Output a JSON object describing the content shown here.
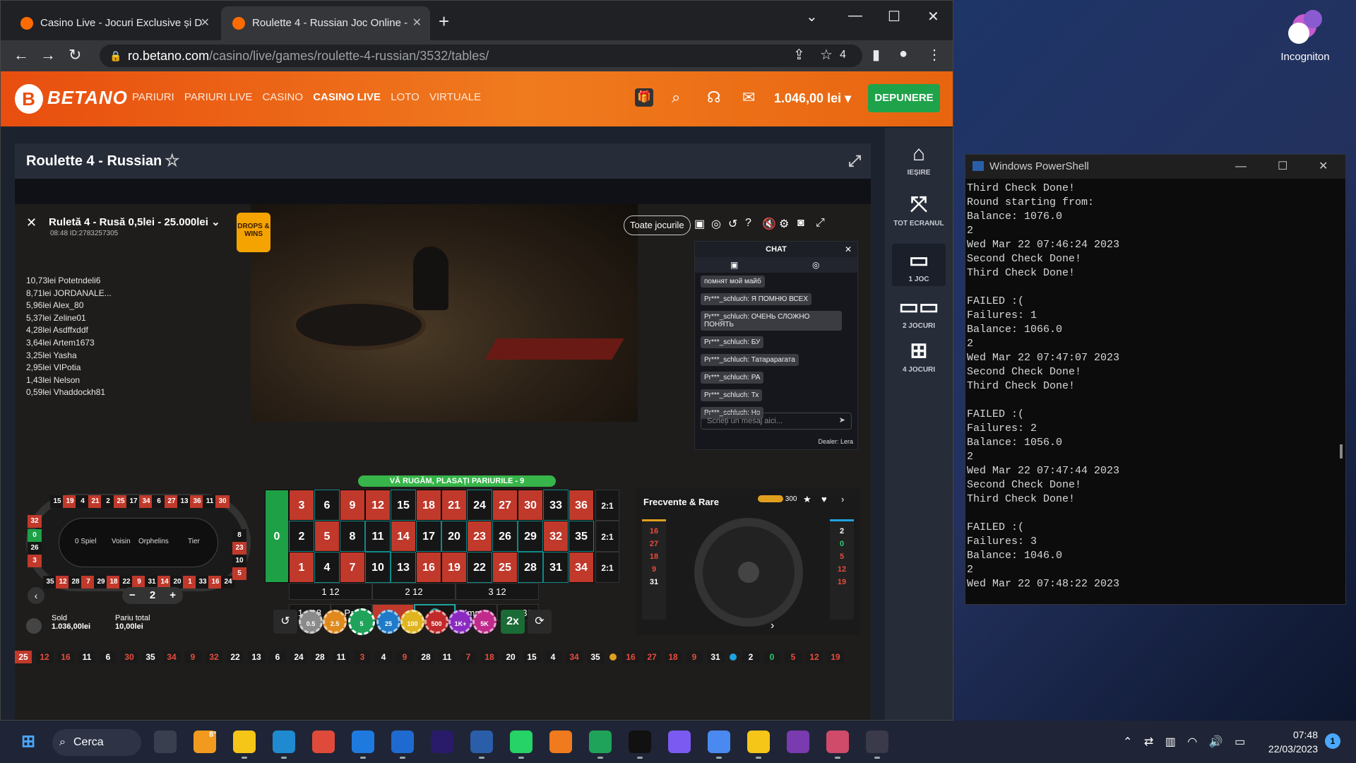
{
  "desktop": {
    "incognito_label": "Incogniton"
  },
  "browser": {
    "tabs": [
      {
        "title": "Casino Live - Jocuri Exclusive și D"
      },
      {
        "title": "Roulette 4 - Russian Joc Online -"
      }
    ],
    "url_host": "ro.betano.com",
    "url_path": "/casino/live/games/roulette-4-russian/3532/tables/",
    "extension_count": "4"
  },
  "betano": {
    "logo": "BETANO",
    "nav": [
      "PARIURI",
      "PARIURI LIVE",
      "CASINO",
      "CASINO LIVE",
      "LOTO",
      "VIRTUALE"
    ],
    "balance": "1.046,00 lei",
    "deposit": "DEPUNERE",
    "game_title": "Roulette 4 - Russian",
    "sidebar": [
      {
        "label": "IEȘIRE",
        "icon": "home-icon"
      },
      {
        "label": "TOT ECRANUL",
        "icon": "fullscreen-icon"
      },
      {
        "label": "1 JOC",
        "icon": "single-screen-icon"
      },
      {
        "label": "2 JOCURI",
        "icon": "two-screens-icon"
      },
      {
        "label": "4 JOCURI",
        "icon": "four-screens-icon"
      }
    ]
  },
  "game": {
    "name": "Ruletă 4 - Rusă 0,5lei - 25.000lei",
    "sub": "08:48 ID:2783257305",
    "drops": "DROPS & WINS",
    "all_games": "Toate jocurile",
    "winners": [
      "10,73lei Potetndeli6",
      "8,71lei JORDANALE...",
      "5,96lei Alex_80",
      "5,37lei Zeline01",
      "4,28lei Asdffxddf",
      "3,64lei Artem1673",
      "3,25lei Yasha",
      "2,95lei VIPotia",
      "1,43lei Nelson",
      "0,59lei Vhaddockh81"
    ],
    "chat": {
      "title": "CHAT",
      "messages": [
        "помнят мой майб",
        "Pr***_schluch: Я ПОМНЮ ВСЕХ",
        "Pr***_schluch: ОЧЕНЬ СЛОЖНО ПОНЯТЬ",
        "Pr***_schluch: БУ",
        "Pr***_schluch: Татарарагата",
        "Pr***_schluch: РА",
        "Pr***_schluch: Тх",
        "Pr***_schluch: Но"
      ],
      "placeholder": "Scrieți un mesaj aici...",
      "dealer": "Dealer: Lera"
    },
    "status": "VĂ RUGĂM, PLASAȚI PARIURILE - 9",
    "race_labels": [
      "0 Spiel",
      "Voisin",
      "Orphelins",
      "Tier"
    ],
    "table_rows": [
      [
        "3",
        "6",
        "9",
        "12",
        "15",
        "18",
        "21",
        "24",
        "27",
        "30",
        "33",
        "36"
      ],
      [
        "2",
        "5",
        "8",
        "11",
        "14",
        "17",
        "20",
        "23",
        "26",
        "29",
        "32",
        "35"
      ],
      [
        "1",
        "4",
        "7",
        "10",
        "13",
        "16",
        "19",
        "22",
        "25",
        "28",
        "31",
        "34"
      ]
    ],
    "red_numbers": [
      "1",
      "3",
      "5",
      "7",
      "9",
      "12",
      "14",
      "16",
      "18",
      "19",
      "21",
      "23",
      "25",
      "27",
      "30",
      "32",
      "34",
      "36"
    ],
    "zero": "0",
    "column_bets": [
      "2:1",
      "2:1",
      "2:1"
    ],
    "dozens": [
      "1 12",
      "2 12",
      "3 12"
    ],
    "outside": [
      "1 - 18",
      "Par",
      "",
      "",
      "Impar",
      "19 - 36"
    ],
    "chips": [
      "0.5",
      "2.5",
      "5",
      "25",
      "100",
      "500",
      "1K+",
      "5K"
    ],
    "double": "2x",
    "bet_multiplier": "2",
    "sold_label": "Sold",
    "sold_value": "1.036,00lei",
    "total_label": "Pariu total",
    "total_value": "10,00lei",
    "freq_title": "Frecvente & Rare",
    "freq_count": "300",
    "cold": [
      "16",
      "27",
      "18",
      "9",
      "31"
    ],
    "hot": [
      "2",
      "0",
      "5",
      "12",
      "19"
    ],
    "history": [
      "25",
      "12",
      "16",
      "11",
      "6",
      "30",
      "35",
      "34",
      "9",
      "32",
      "22",
      "13",
      "6",
      "24",
      "28",
      "11",
      "3",
      "4",
      "9",
      "28",
      "11",
      "7",
      "18",
      "20",
      "15",
      "4",
      "34",
      "35"
    ],
    "history_cold": [
      "16",
      "27",
      "18",
      "9",
      "31"
    ],
    "history_hot": [
      "2",
      "0",
      "5",
      "12",
      "19"
    ]
  },
  "powershell": {
    "title": "Windows PowerShell",
    "lines": "Third Check Done!\nRound starting from:\nBalance: 1076.0\n2\nWed Mar 22 07:46:24 2023\nSecond Check Done!\nThird Check Done!\n\nFAILED :(\nFailures: 1\nBalance: 1066.0\n2\nWed Mar 22 07:47:07 2023\nSecond Check Done!\nThird Check Done!\n\nFAILED :(\nFailures: 2\nBalance: 1056.0\n2\nWed Mar 22 07:47:44 2023\nSecond Check Done!\nThird Check Done!\n\nFAILED :(\nFailures: 3\nBalance: 1046.0\n2\nWed Mar 22 07:48:22 2023"
  },
  "taskbar": {
    "search": "Cerca",
    "temp": "8°",
    "time": "07:48",
    "date": "22/03/2023",
    "notif": "1",
    "apps": [
      "task-view",
      "weather",
      "explorer",
      "edge",
      "chrome",
      "store",
      "vscode",
      "after-effects",
      "powershell",
      "whatsapp",
      "fl-studio",
      "aitl",
      "agi",
      "figma",
      "chrome-alt",
      "bot",
      "incogniton",
      "snip",
      "obs"
    ]
  }
}
